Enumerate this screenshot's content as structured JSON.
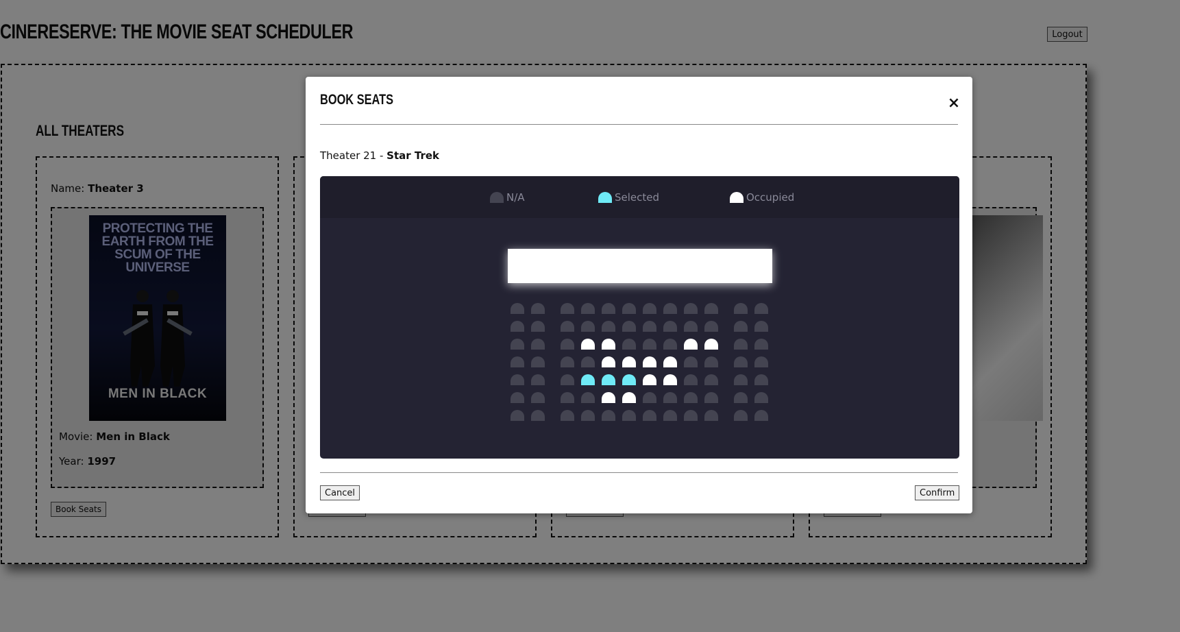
{
  "header": {
    "app_title": "CINERESERVE: THE MOVIE SEAT SCHEDULER",
    "logout_label": "Logout"
  },
  "theaters_section": {
    "title": "ALL THEATERS",
    "first_card": {
      "name_label": "Name:",
      "name_value": "Theater 3",
      "poster_tagline": "PROTECTING THE EARTH FROM THE SCUM OF THE UNIVERSE",
      "poster_title": "MEN IN BLACK",
      "movie_label": "Movie:",
      "movie_value": "Men in Black",
      "year_label": "Year:",
      "year_value": "1997",
      "book_label": "Book Seats"
    }
  },
  "modal": {
    "title": "BOOK SEATS",
    "close_symbol": "×",
    "theater_prefix": "Theater 21 - ",
    "movie_name": "Star Trek",
    "legend": {
      "na": "N/A",
      "selected": "Selected",
      "occupied": "Occupied"
    },
    "seat_rows": [
      [
        "n",
        "n",
        "n",
        "n",
        "n",
        "n",
        "n",
        "n",
        "n",
        "n",
        "n",
        "n"
      ],
      [
        "n",
        "n",
        "n",
        "n",
        "n",
        "n",
        "n",
        "n",
        "n",
        "n",
        "n",
        "n"
      ],
      [
        "n",
        "n",
        "n",
        "o",
        "o",
        "n",
        "n",
        "n",
        "o",
        "o",
        "n",
        "n"
      ],
      [
        "n",
        "n",
        "n",
        "n",
        "o",
        "o",
        "o",
        "o",
        "n",
        "n",
        "n",
        "n"
      ],
      [
        "n",
        "n",
        "n",
        "s",
        "s",
        "s",
        "o",
        "o",
        "n",
        "n",
        "n",
        "n"
      ],
      [
        "n",
        "n",
        "n",
        "n",
        "o",
        "o",
        "n",
        "n",
        "n",
        "n",
        "n",
        "n"
      ],
      [
        "n",
        "n",
        "n",
        "n",
        "n",
        "n",
        "n",
        "n",
        "n",
        "n",
        "n",
        "n"
      ]
    ],
    "cancel_label": "Cancel",
    "confirm_label": "Confirm"
  },
  "colors": {
    "seat_na": "#444451",
    "seat_selected": "#6feaf6",
    "seat_occupied": "#ffffff",
    "panel_bg": "#242333"
  }
}
